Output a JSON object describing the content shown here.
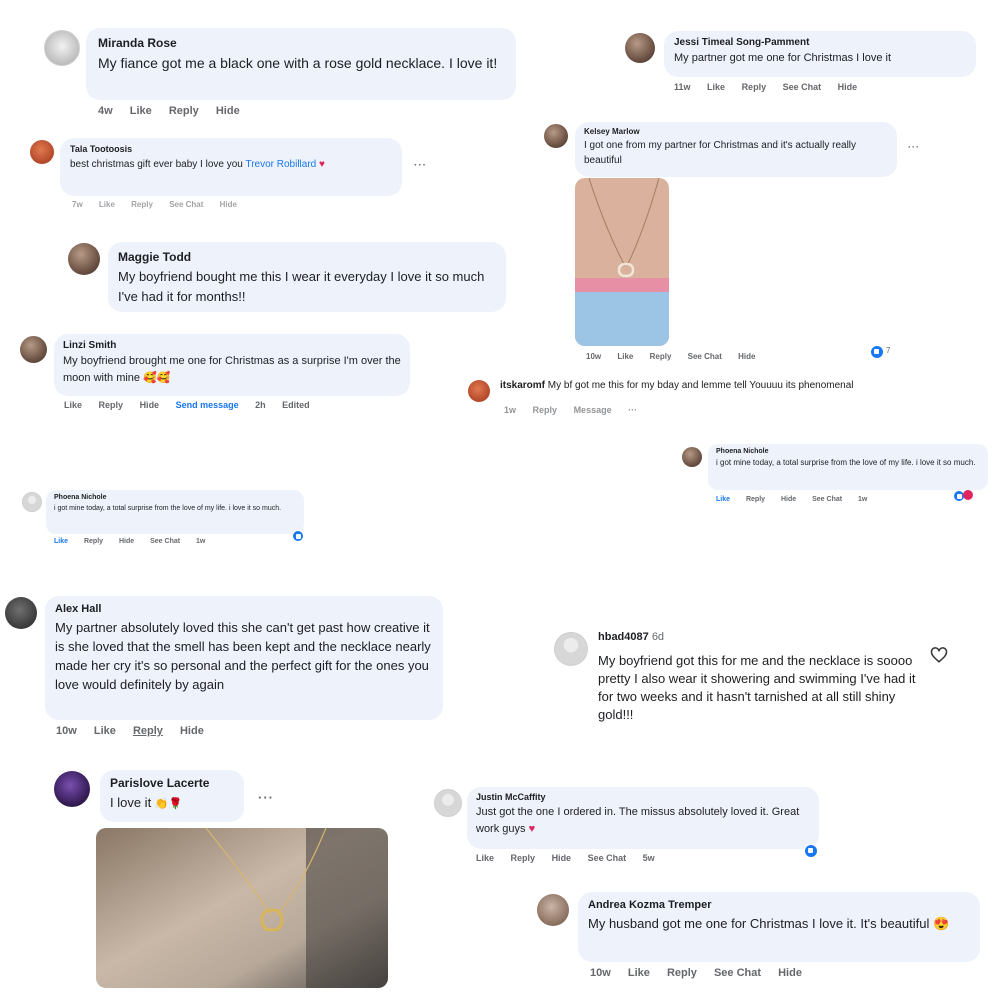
{
  "comments": [
    {
      "name": "Miranda Rose",
      "text": "My fiance got me a black one with a rose gold necklace. I love it!",
      "time": "4w",
      "a1": "Like",
      "a2": "Reply",
      "a3": "Hide"
    },
    {
      "name": "Tala Tootoosis",
      "text": "best christmas gift ever baby I love you",
      "tag": "Trevor Robillard",
      "emoji": "♥",
      "time": "7w",
      "a1": "Like",
      "a2": "Reply",
      "a3": "See Chat",
      "a4": "Hide"
    },
    {
      "name": "Maggie Todd",
      "text": "My boyfriend bought me this I wear it everyday I love it so much I've had it for months!!"
    },
    {
      "name": "Linzi Smith",
      "text": "My boyfriend brought me one for Christmas as a surprise I'm over the moon with mine",
      "emoji": "🥰🥰",
      "a1": "Like",
      "a2": "Reply",
      "a3": "Hide",
      "a4": "Send message",
      "time": "2h",
      "a5": "Edited"
    },
    {
      "name": "Phoena Nichole",
      "text": "i got mine today, a total surprise from the love of my life. i love it so much.",
      "a1": "Like",
      "a2": "Reply",
      "a3": "Hide",
      "a4": "See Chat",
      "time": "1w"
    },
    {
      "name": "Alex Hall",
      "text": "My partner absolutely loved this she can't get past how creative it is she loved that the smell has been kept and the necklace nearly made her cry it's so personal and the perfect gift for the ones you love would definitely by again",
      "time": "10w",
      "a1": "Like",
      "a2": "Reply",
      "a3": "Hide"
    },
    {
      "name": "Parislove Lacerte",
      "text": "I love it",
      "emoji": "👏🌹"
    },
    {
      "name": "Jessi Timeal Song-Pamment",
      "text": "My partner got me one for Christmas I love it",
      "time": "11w",
      "a1": "Like",
      "a2": "Reply",
      "a3": "See Chat",
      "a4": "Hide"
    },
    {
      "name": "Kelsey Marlow",
      "text": "I got one from my partner for Christmas and it's actually really beautiful",
      "time": "10w",
      "a1": "Like",
      "a2": "Reply",
      "a3": "See Chat",
      "a4": "Hide",
      "count": "7"
    },
    {
      "name": "itskaromf",
      "text": "My bf got me this for my bday and lemme tell Youuuu its phenomenal",
      "time": "1w",
      "a1": "Reply",
      "a2": "Message"
    },
    {
      "name": "Phoena Nichole",
      "text": "i got mine today, a total surprise from the love of my life. i love it so much.",
      "a1": "Like",
      "a2": "Reply",
      "a3": "Hide",
      "a4": "See Chat",
      "time": "1w"
    },
    {
      "name": "hbad4087",
      "time": "6d",
      "text": "My boyfriend got this for me and the necklace is soooo pretty I also wear it showering and swimming I've had it for two weeks and it hasn't tarnished at all still shiny gold!!!"
    },
    {
      "name": "Justin McCaffity",
      "text": "Just got the one I ordered in. The missus absolutely loved it. Great work guys",
      "emoji": "♥",
      "a1": "Like",
      "a2": "Reply",
      "a3": "Hide",
      "a4": "See Chat",
      "time": "5w"
    },
    {
      "name": "Andrea Kozma Tremper",
      "text": "My husband got me one for Christmas I love it. It's beautiful",
      "emoji": "😍",
      "time": "10w",
      "a1": "Like",
      "a2": "Reply",
      "a3": "See Chat",
      "a4": "Hide"
    }
  ],
  "icons": {
    "more": "more-dots-icon",
    "like": "like-reaction-icon",
    "heart": "heart-outline-icon"
  }
}
